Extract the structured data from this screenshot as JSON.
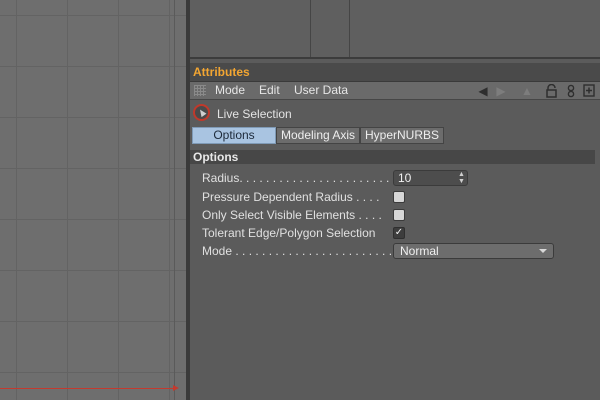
{
  "attributes": {
    "title": "Attributes",
    "menu": [
      "Mode",
      "Edit",
      "User Data"
    ],
    "toolbar_icons": [
      "back-arrow-icon",
      "forward-arrow-icon",
      "up-arrow-icon",
      "lock-icon",
      "link-icon",
      "new-panel-icon"
    ]
  },
  "tool": {
    "name": "Live Selection",
    "icon": "live-selection-icon"
  },
  "tabs": [
    {
      "label": "Options",
      "active": true
    },
    {
      "label": "Modeling Axis",
      "active": false
    },
    {
      "label": "HyperNURBS",
      "active": false
    }
  ],
  "options": {
    "header": "Options",
    "radius": {
      "label": "Radius. . . . . . . . . . . . . . . . . . . . . . . .",
      "value": "10"
    },
    "pressure_radius": {
      "label": "Pressure Dependent Radius . . . .",
      "checked": false
    },
    "visible_only": {
      "label": "Only Select Visible Elements . . . .",
      "checked": false
    },
    "tolerant": {
      "label": "Tolerant Edge/Polygon Selection",
      "checked": true,
      "check_glyph": "✓"
    },
    "mode": {
      "label": "Mode . . . . . . . . . . . . . . . . . . . . . . . . .",
      "value": "Normal"
    }
  },
  "colors": {
    "title_accent": "#f3a632",
    "tab_active": "#a9c4e1",
    "axis_red": "#c43a2e"
  }
}
